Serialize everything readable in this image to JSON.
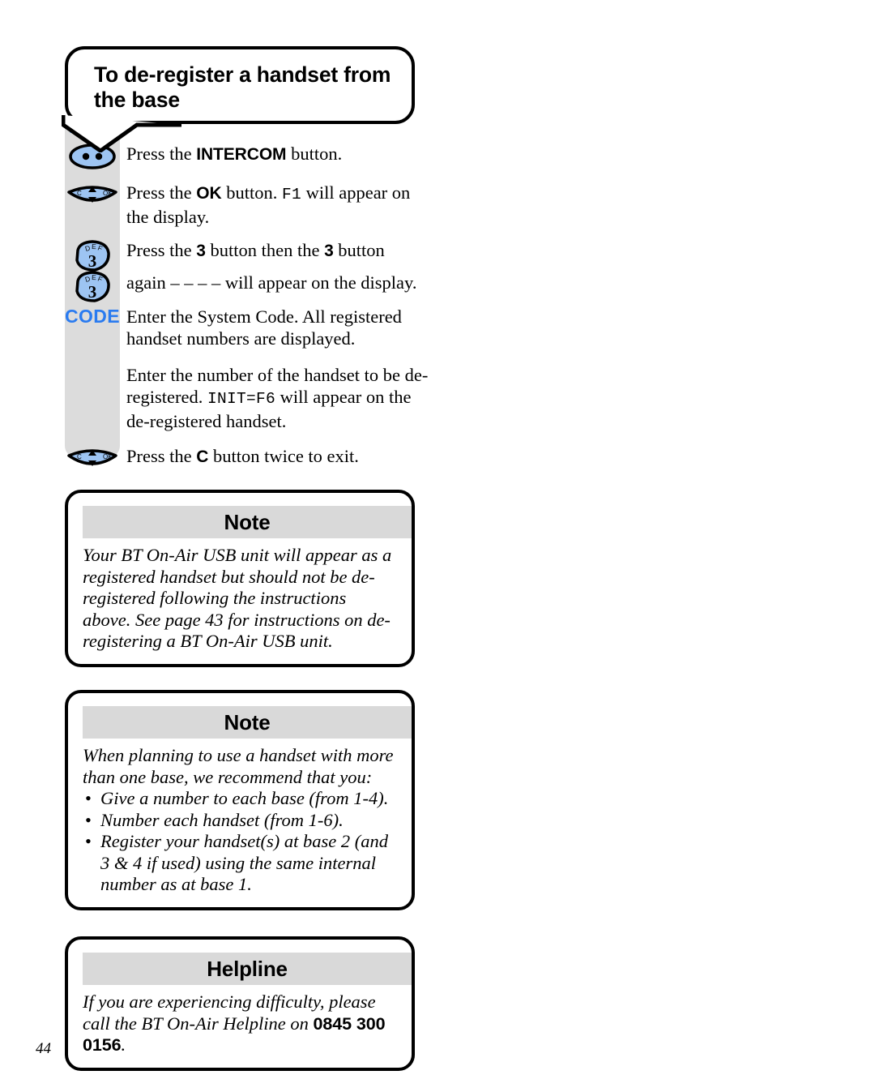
{
  "page": {
    "number": "44"
  },
  "title_bubble": {
    "line1": "To de-register a handset from",
    "line2": "the base"
  },
  "steps": {
    "intercom_caption": "Intercom",
    "code_label": "CODE",
    "items": [
      {
        "icon": "intercom-button-icon",
        "text_before": "Press the ",
        "bold": "INTERCOM",
        "text_after": " button."
      },
      {
        "icon": "ok-navigation-button-icon",
        "text_before": "Press the ",
        "bold": "OK",
        "text_mid": " button. ",
        "mono": "F1",
        "text_after": " will appear on the display."
      },
      {
        "icon": "key-3-icon",
        "text_before": "Press the ",
        "bold": "3",
        "text_mid": " button then the ",
        "bold2": "3",
        "text_after": " button"
      },
      {
        "icon": "key-3-icon",
        "text_before": "again ",
        "dashes": "– – – –",
        "text_after": " will appear on the display."
      },
      {
        "icon": "code-label-icon",
        "text": "Enter the System Code. All registered handset numbers are displayed."
      },
      {
        "icon": "none",
        "text_before": "Enter the number of the handset to be de-registered. ",
        "mono": "INIT=F6",
        "text_after": " will appear on the de-registered handset."
      },
      {
        "icon": "c-navigation-button-icon",
        "text_before": "Press the ",
        "bold": "C",
        "text_after": " button twice to exit."
      }
    ]
  },
  "key_art": {
    "intercom_fill": "#9dc4f2",
    "key_fill": "#9dc4f2",
    "nav_fill": "#9dc4f2",
    "key_3_digit": "3",
    "key_3_letters": "DEF",
    "nav_left_label": "C",
    "nav_right_label": "OK"
  },
  "note_1": {
    "heading": "Note",
    "body": "Your BT On-Air USB unit will appear as a registered handset but should not be de-registered following the instructions above. See page 43 for instructions on de-registering a BT On-Air USB unit."
  },
  "note_2": {
    "heading": "Note",
    "intro": "When planning to use a handset with more than one base, we recommend that you:",
    "bullets": [
      "Give a number to each base (from 1-4).",
      "Number each handset (from 1-6).",
      "Register your handset(s) at base 2 (and 3 & 4 if used) using the same internal number as at base 1."
    ]
  },
  "helpline": {
    "heading": "Helpline",
    "body_before": "If you are experiencing difficulty, please call the BT On-Air Helpline on ",
    "phone": "0845 300 0156",
    "body_after": "."
  }
}
